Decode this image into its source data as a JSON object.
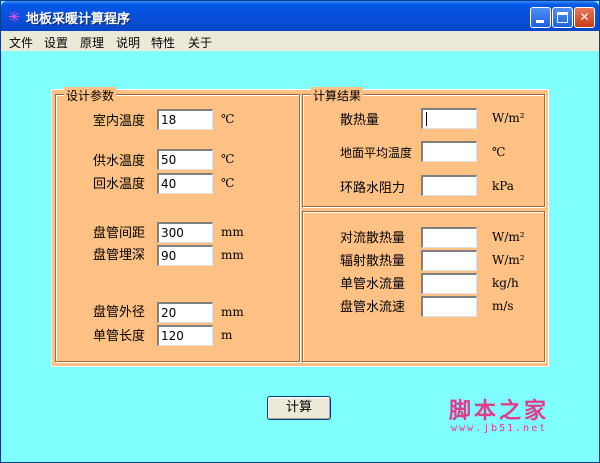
{
  "window": {
    "title": "地板采暖计算程序",
    "app_icon": "✳"
  },
  "menu": [
    "文件",
    "设置",
    "原理",
    "说明",
    "特性",
    "关于"
  ],
  "design_params": {
    "title": "设计参数",
    "rows": [
      {
        "label": "室内温度",
        "value": "18",
        "unit": "℃"
      },
      {
        "label": "供水温度",
        "value": "50",
        "unit": "℃"
      },
      {
        "label": "回水温度",
        "value": "40",
        "unit": "℃"
      },
      {
        "label": "盘管间距",
        "value": "300",
        "unit": "mm"
      },
      {
        "label": "盘管埋深",
        "value": "90",
        "unit": "mm"
      },
      {
        "label": "盘管外径",
        "value": "20",
        "unit": "mm"
      },
      {
        "label": "单管长度",
        "value": "120",
        "unit": "m"
      }
    ]
  },
  "results": {
    "title": "计算结果",
    "top_rows": [
      {
        "label": "散热量",
        "value": "",
        "unit": "W/m²"
      },
      {
        "label": "地面平均温度",
        "value": "",
        "unit": "℃"
      },
      {
        "label": "环路水阻力",
        "value": "",
        "unit": "kPa"
      }
    ],
    "bottom_rows": [
      {
        "label": "对流散热量",
        "value": "",
        "unit": "W/m²"
      },
      {
        "label": "辐射散热量",
        "value": "",
        "unit": "W/m²"
      },
      {
        "label": "单管水流量",
        "value": "",
        "unit": "kg/h"
      },
      {
        "label": "盘管水流速",
        "value": "",
        "unit": "m/s"
      }
    ]
  },
  "calc_button": "计算",
  "watermark": {
    "text": "脚本之家",
    "url": "www.jb51.net"
  },
  "colors": {
    "client_bg": "#80ffff",
    "panel_bg": "#ffc184",
    "watermark": "#e03c8a"
  }
}
